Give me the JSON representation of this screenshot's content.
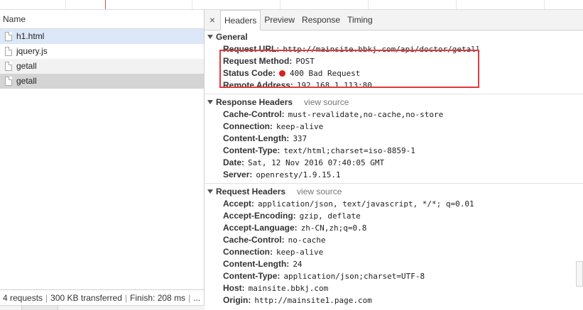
{
  "left_pane": {
    "header": "Name",
    "files": [
      {
        "name": "h1.html",
        "state": "selected"
      },
      {
        "name": "jquery.js",
        "state": "normal"
      },
      {
        "name": "getall",
        "state": "gray"
      },
      {
        "name": "getall",
        "state": "dark"
      }
    ],
    "status": {
      "requests": "4 requests",
      "transferred": "300 KB transferred",
      "finish": "Finish: 208 ms",
      "more": "..."
    }
  },
  "tabs": {
    "close": "×",
    "items": [
      "Headers",
      "Preview",
      "Response",
      "Timing"
    ],
    "active": "Headers"
  },
  "general": {
    "title": "General",
    "rows": [
      {
        "key": "Request URL:",
        "value": "http://mainsite.bbkj.com/api/doctor/getall"
      },
      {
        "key": "Request Method:",
        "value": "POST"
      },
      {
        "key": "Status Code:",
        "value": "400 Bad Request"
      },
      {
        "key": "Remote Address:",
        "value": "192.168.1.113:80"
      }
    ]
  },
  "response_headers": {
    "title": "Response Headers",
    "view_source": "view source",
    "rows": [
      {
        "key": "Cache-Control:",
        "value": "must-revalidate,no-cache,no-store"
      },
      {
        "key": "Connection:",
        "value": "keep-alive"
      },
      {
        "key": "Content-Length:",
        "value": "337"
      },
      {
        "key": "Content-Type:",
        "value": "text/html;charset=iso-8859-1"
      },
      {
        "key": "Date:",
        "value": "Sat, 12 Nov 2016 07:40:05 GMT"
      },
      {
        "key": "Server:",
        "value": "openresty/1.9.15.1"
      }
    ]
  },
  "request_headers": {
    "title": "Request Headers",
    "view_source": "view source",
    "rows": [
      {
        "key": "Accept:",
        "value": "application/json, text/javascript, */*; q=0.01"
      },
      {
        "key": "Accept-Encoding:",
        "value": "gzip, deflate"
      },
      {
        "key": "Accept-Language:",
        "value": "zh-CN,zh;q=0.8"
      },
      {
        "key": "Cache-Control:",
        "value": "no-cache"
      },
      {
        "key": "Connection:",
        "value": "keep-alive"
      },
      {
        "key": "Content-Length:",
        "value": "24"
      },
      {
        "key": "Content-Type:",
        "value": "application/json;charset=UTF-8"
      },
      {
        "key": "Host:",
        "value": "mainsite.bbkj.com"
      },
      {
        "key": "Origin:",
        "value": "http://mainsite1.page.com"
      }
    ]
  },
  "colors": {
    "highlight_box": "#e03a3e",
    "status_dot": "#d9201c",
    "selected_row": "#dce8f8"
  }
}
